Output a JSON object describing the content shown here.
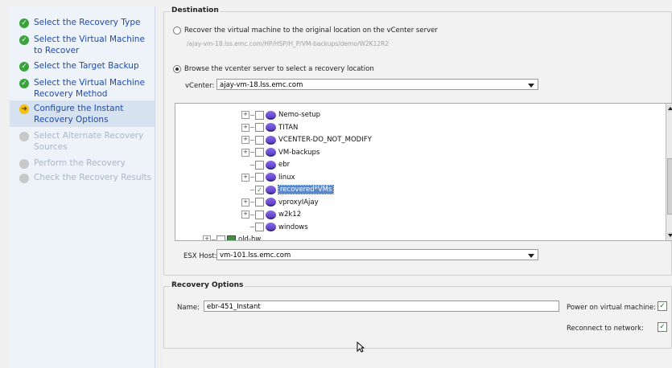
{
  "steps": [
    {
      "label": "Select the Recovery Type",
      "state": "done"
    },
    {
      "label": "Select the Virtual Machine to Recover",
      "state": "done"
    },
    {
      "label": "Select the Target Backup",
      "state": "done"
    },
    {
      "label": "Select the Virtual Machine Recovery Method",
      "state": "done"
    },
    {
      "label": "Configure the Instant Recovery Options",
      "state": "current"
    },
    {
      "label": "Select Alternate Recovery Sources",
      "state": "pending"
    },
    {
      "label": "Perform the Recovery",
      "state": "pending"
    },
    {
      "label": "Check the Recovery Results",
      "state": "pending"
    }
  ],
  "destination": {
    "title": "Destination",
    "option_original": "Recover the virtual machine to the original location on the vCenter server",
    "original_path": "/ajay-vm-18.lss.emc.com/HP/HSP/H_P/VM-backups/demo/W2K12R2",
    "option_browse": "Browse the vcenter server to select a recovery location",
    "vcenter_label": "vCenter:",
    "vcenter_value": "ajay-vm-18.lss.emc.com",
    "esx_label": "ESX Host:",
    "esx_value": "vm-101.lss.emc.com"
  },
  "tree": [
    {
      "label": "Nemo-setup",
      "expander": "+"
    },
    {
      "label": "TITAN",
      "expander": "+"
    },
    {
      "label": "VCENTER-DO_NOT_MODIFY",
      "expander": "+"
    },
    {
      "label": "VM-backups",
      "expander": "+"
    },
    {
      "label": "ebr",
      "expander": ""
    },
    {
      "label": "linux",
      "expander": "+"
    },
    {
      "label": "recovered*VMs",
      "expander": "",
      "checked": true,
      "selected": true
    },
    {
      "label": "vproxyIAjay",
      "expander": "+"
    },
    {
      "label": "w2k12",
      "expander": "+"
    },
    {
      "label": "windows",
      "expander": ""
    },
    {
      "label": "old-hw",
      "expander": "+",
      "host": true
    }
  ],
  "recovery": {
    "title": "Recovery Options",
    "name_label": "Name:",
    "name_value": "ebr-451_Instant",
    "power_label": "Power on virtual machine:",
    "reconnect_label": "Reconnect to network:"
  },
  "icons": {
    "done": "check-circle-icon",
    "current": "arrow-circle-icon",
    "pending": "gray-circle-icon"
  }
}
